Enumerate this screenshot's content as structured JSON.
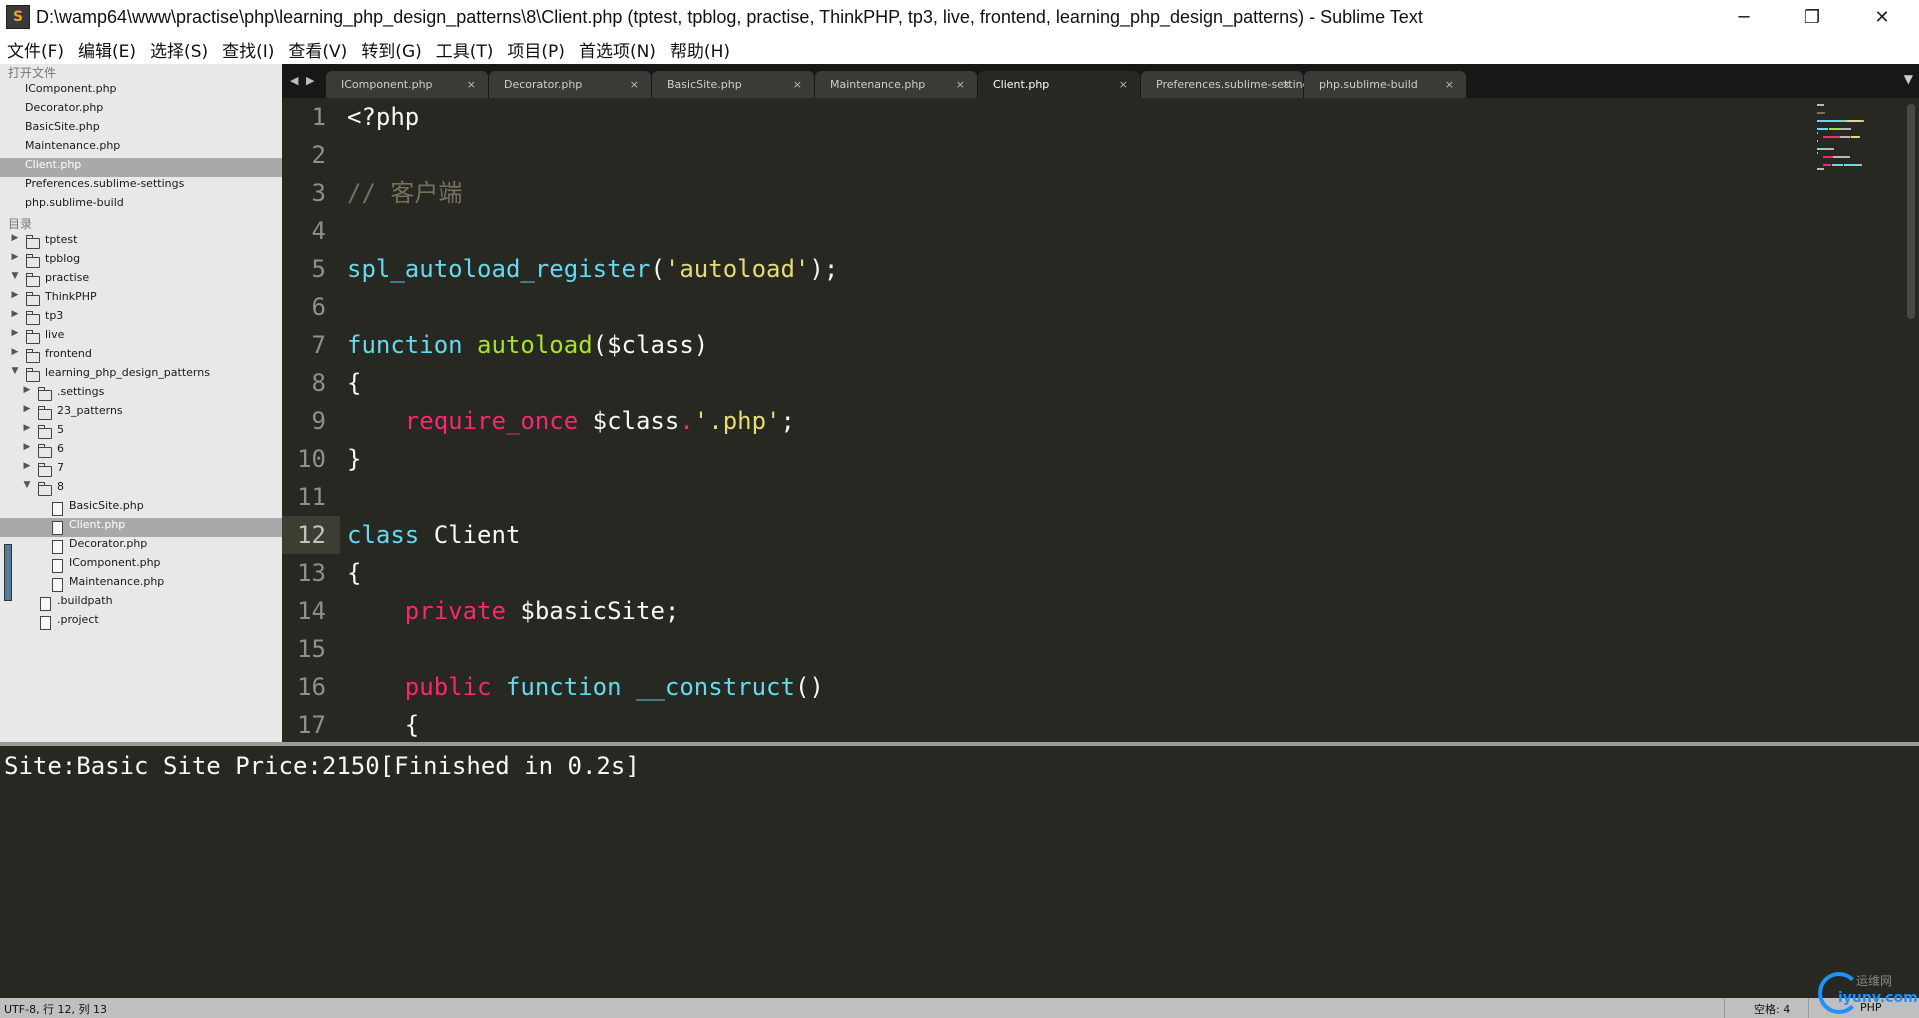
{
  "window": {
    "title": "D:\\wamp64\\www\\practise\\php\\learning_php_design_patterns\\8\\Client.php (tptest, tpblog, practise, ThinkPHP, tp3, live, frontend, learning_php_design_patterns) - Sublime Text",
    "app_icon": "S",
    "minimize": "─",
    "maximize": "❐",
    "close": "✕"
  },
  "menu": [
    "文件(F)",
    "编辑(E)",
    "选择(S)",
    "查找(I)",
    "查看(V)",
    "转到(G)",
    "工具(T)",
    "项目(P)",
    "首选项(N)",
    "帮助(H)"
  ],
  "sidebar": {
    "open_files_header": "打开文件",
    "open_files": [
      "IComponent.php",
      "Decorator.php",
      "BasicSite.php",
      "Maintenance.php",
      "Client.php",
      "Preferences.sublime-settings",
      "php.sublime-build"
    ],
    "folders_header": "目录",
    "tree": [
      {
        "label": "tptest",
        "type": "folder",
        "depth": 0,
        "open": false
      },
      {
        "label": "tpblog",
        "type": "folder",
        "depth": 0,
        "open": false
      },
      {
        "label": "practise",
        "type": "folder",
        "depth": 0,
        "open": true
      },
      {
        "label": "ThinkPHP",
        "type": "folder",
        "depth": 0,
        "open": false
      },
      {
        "label": "tp3",
        "type": "folder",
        "depth": 0,
        "open": false
      },
      {
        "label": "live",
        "type": "folder",
        "depth": 0,
        "open": false
      },
      {
        "label": "frontend",
        "type": "folder",
        "depth": 0,
        "open": false
      },
      {
        "label": "learning_php_design_patterns",
        "type": "folder",
        "depth": 0,
        "open": true
      },
      {
        "label": ".settings",
        "type": "folder",
        "depth": 1,
        "open": false
      },
      {
        "label": "23_patterns",
        "type": "folder",
        "depth": 1,
        "open": false
      },
      {
        "label": "5",
        "type": "folder",
        "depth": 1,
        "open": false
      },
      {
        "label": "6",
        "type": "folder",
        "depth": 1,
        "open": false
      },
      {
        "label": "7",
        "type": "folder",
        "depth": 1,
        "open": false
      },
      {
        "label": "8",
        "type": "folder",
        "depth": 1,
        "open": true
      },
      {
        "label": "BasicSite.php",
        "type": "file",
        "depth": 2
      },
      {
        "label": "Client.php",
        "type": "file",
        "depth": 2,
        "selected": true
      },
      {
        "label": "Decorator.php",
        "type": "file",
        "depth": 2
      },
      {
        "label": "IComponent.php",
        "type": "file",
        "depth": 2
      },
      {
        "label": "Maintenance.php",
        "type": "file",
        "depth": 2
      },
      {
        "label": ".buildpath",
        "type": "file",
        "depth": 1
      },
      {
        "label": ".project",
        "type": "file",
        "depth": 1
      }
    ]
  },
  "tabs": {
    "nav_left": "◀",
    "nav_right": "▶",
    "dropdown": "▼",
    "close_glyph": "×",
    "items": [
      {
        "label": "IComponent.php",
        "active": false
      },
      {
        "label": "Decorator.php",
        "active": false
      },
      {
        "label": "BasicSite.php",
        "active": false
      },
      {
        "label": "Maintenance.php",
        "active": false
      },
      {
        "label": "Client.php",
        "active": true
      },
      {
        "label": "Preferences.sublime-settings",
        "active": false
      },
      {
        "label": "php.sublime-build",
        "active": false
      }
    ]
  },
  "editor": {
    "current_line": 12,
    "lines": [
      {
        "n": "1",
        "tokens": [
          {
            "t": "<?php",
            "c": ""
          }
        ]
      },
      {
        "n": "2",
        "tokens": []
      },
      {
        "n": "3",
        "tokens": [
          {
            "t": "// 客户端",
            "c": "kw-cmt"
          }
        ]
      },
      {
        "n": "4",
        "tokens": []
      },
      {
        "n": "5",
        "tokens": [
          {
            "t": "spl_autoload_register",
            "c": "kw-blue"
          },
          {
            "t": "(",
            "c": ""
          },
          {
            "t": "'autoload'",
            "c": "kw-yellow"
          },
          {
            "t": ");",
            "c": ""
          }
        ]
      },
      {
        "n": "6",
        "tokens": []
      },
      {
        "n": "7",
        "tokens": [
          {
            "t": "function",
            "c": "kw-blue"
          },
          {
            "t": " ",
            "c": ""
          },
          {
            "t": "autoload",
            "c": "kw-green"
          },
          {
            "t": "($class)",
            "c": ""
          }
        ]
      },
      {
        "n": "8",
        "tokens": [
          {
            "t": "{",
            "c": ""
          }
        ]
      },
      {
        "n": "9",
        "tokens": [
          {
            "t": "    ",
            "c": ""
          },
          {
            "t": "require_once",
            "c": "kw-red"
          },
          {
            "t": " $class",
            "c": ""
          },
          {
            "t": ".",
            "c": "kw-red"
          },
          {
            "t": "'.php'",
            "c": "kw-yellow"
          },
          {
            "t": ";",
            "c": ""
          }
        ]
      },
      {
        "n": "10",
        "tokens": [
          {
            "t": "}",
            "c": ""
          }
        ]
      },
      {
        "n": "11",
        "tokens": []
      },
      {
        "n": "12",
        "tokens": [
          {
            "t": "class",
            "c": "kw-blue"
          },
          {
            "t": " Client",
            "c": ""
          }
        ]
      },
      {
        "n": "13",
        "tokens": [
          {
            "t": "{",
            "c": ""
          }
        ]
      },
      {
        "n": "14",
        "tokens": [
          {
            "t": "    ",
            "c": ""
          },
          {
            "t": "private",
            "c": "kw-red"
          },
          {
            "t": " $basicSite;",
            "c": ""
          }
        ]
      },
      {
        "n": "15",
        "tokens": []
      },
      {
        "n": "16",
        "tokens": [
          {
            "t": "    ",
            "c": ""
          },
          {
            "t": "public",
            "c": "kw-red"
          },
          {
            "t": " ",
            "c": ""
          },
          {
            "t": "function",
            "c": "kw-blue"
          },
          {
            "t": " ",
            "c": ""
          },
          {
            "t": "__construct",
            "c": "kw-blue"
          },
          {
            "t": "()",
            "c": ""
          }
        ]
      },
      {
        "n": "17",
        "tokens": [
          {
            "t": "    {",
            "c": ""
          }
        ]
      }
    ]
  },
  "output": {
    "text": "Site:Basic Site Price:2150[Finished in 0.2s]"
  },
  "status": {
    "position": "UTF-8, 行 12, 列 13",
    "indent": "空格: 4",
    "syntax": "PHP"
  },
  "watermark": {
    "line1": "运维网",
    "line2": "iyunv.com"
  },
  "colors": {
    "editor_bg": "#272822",
    "sidebar_bg": "#e8e8e8",
    "keyword_blue": "#66d9ef",
    "keyword_red": "#f92672",
    "function_green": "#a6e22e",
    "string_yellow": "#e6db74",
    "comment": "#75715e"
  }
}
